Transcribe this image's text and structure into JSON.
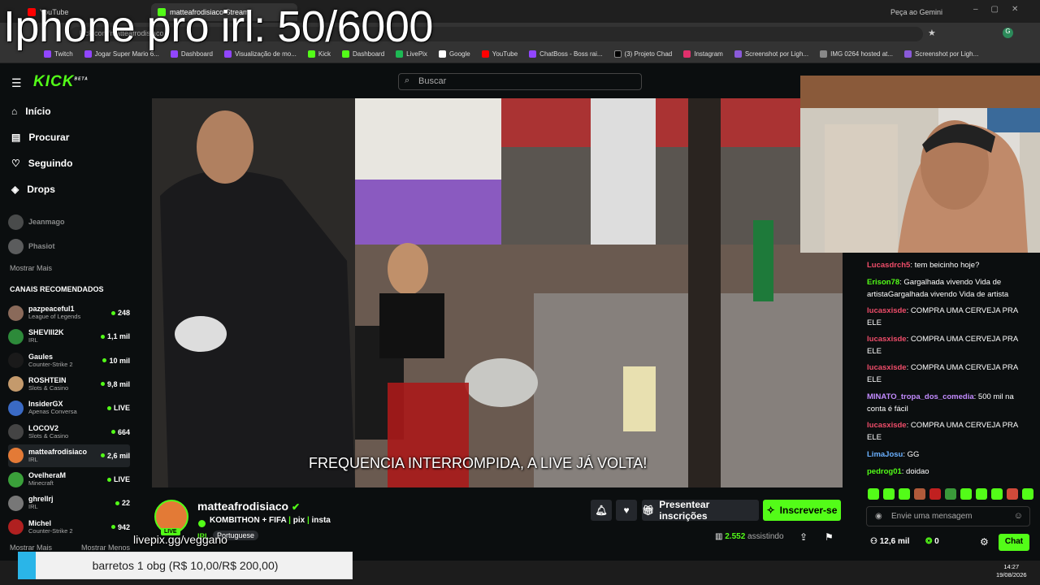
{
  "overlay": {
    "title": "Iphone pro irl: 50/6000"
  },
  "browser": {
    "tabs": [
      "YouTube",
      "matteafrodisiaco Stream",
      "Peça ao Gemini"
    ],
    "url": "kick.com/matteafrodisiaco",
    "bookmarks": [
      "Twitch",
      "Jogar Super Mario 6...",
      "Dashboard",
      "Visualização de mo...",
      "Kick",
      "Dashboard",
      "LivePix",
      "Google",
      "YouTube",
      "ChatBoss - Boss rai...",
      "(3) Projeto Chad",
      "Instagram",
      "Screenshot por Ligh...",
      "IMG 0264 hosted at...",
      "Screenshot por Ligh..."
    ]
  },
  "header": {
    "logo": "KICK",
    "logo_badge": "BETA",
    "search_placeholder": "Buscar"
  },
  "sidebar": {
    "nav": [
      {
        "label": "Início",
        "icon": "home-icon"
      },
      {
        "label": "Procurar",
        "icon": "browse-icon"
      },
      {
        "label": "Seguindo",
        "icon": "heart-icon"
      },
      {
        "label": "Drops",
        "icon": "drops-icon"
      }
    ],
    "following": [
      {
        "name": "Jeanmago"
      },
      {
        "name": "Phasiot"
      }
    ],
    "show_more": "Mostrar Mais",
    "recommended_title": "CANAIS RECOMENDADOS",
    "recommended": [
      {
        "name": "pazpeaceful1",
        "category": "League of Legends",
        "viewers": "248",
        "color": "#8a6a5a"
      },
      {
        "name": "SHEVIII2K",
        "category": "IRL",
        "viewers": "1,1 mil",
        "color": "#2d8a3a"
      },
      {
        "name": "Gaules",
        "category": "Counter-Strike 2",
        "viewers": "10 mil",
        "color": "#1a1a1a"
      },
      {
        "name": "ROSHTEIN",
        "category": "Slots & Casino",
        "viewers": "9,8 mil",
        "color": "#c49a6c"
      },
      {
        "name": "InsiderGX",
        "category": "Apenas Conversa",
        "viewers": "LIVE",
        "color": "#3a6ac4"
      },
      {
        "name": "LOCOV2",
        "category": "Slots & Casino",
        "viewers": "664",
        "color": "#444"
      },
      {
        "name": "matteafrodisiaco",
        "category": "IRL",
        "viewers": "2,6 mil",
        "color": "#e37a36"
      },
      {
        "name": "OvelheraM",
        "category": "Minecraft",
        "viewers": "LIVE",
        "color": "#3aa03a"
      },
      {
        "name": "ghrellrj",
        "category": "IRL",
        "viewers": "22",
        "color": "#777"
      },
      {
        "name": "Michel",
        "category": "Counter-Strike 2",
        "viewers": "942",
        "color": "#b02020"
      }
    ],
    "show_more2": "Mostrar Mais",
    "show_less": "Mostrar Menos"
  },
  "video": {
    "subtitle": "FREQUENCIA INTERROMPIDA, A LIVE JÁ VOLTA!"
  },
  "stream": {
    "streamer": "matteafrodisiaco",
    "title": "KOMBITHON + FIFA",
    "links": [
      "pix",
      "insta"
    ],
    "category": "IRL",
    "language": "Portuguese",
    "live_badge": "LIVE",
    "viewers": "2.552",
    "viewers_label": "assistindo",
    "gift_label": "Presentear inscrições",
    "subscribe_label": "Inscrever-se"
  },
  "chat": {
    "messages": [
      {
        "user": "Lucasdrch5",
        "color": "#f04d6a",
        "text": "tem beicinho hoje?"
      },
      {
        "user": "Erison78",
        "color": "#53fc18",
        "text": "Gargalhada vivendo Vida de artistaGargalhada vivendo Vida de artista"
      },
      {
        "user": "lucasxisde",
        "color": "#f04d6a",
        "text": "COMPRA UMA CERVEJA PRA ELE"
      },
      {
        "user": "lucasxisde",
        "color": "#f04d6a",
        "text": "COMPRA UMA CERVEJA PRA ELE"
      },
      {
        "user": "lucasxisde",
        "color": "#f04d6a",
        "text": "COMPRA UMA CERVEJA PRA ELE"
      },
      {
        "user": "MINATO_tropa_dos_comedia",
        "color": "#c38bff",
        "text": "500 mil na conta é fácil"
      },
      {
        "user": "lucasxisde",
        "color": "#f04d6a",
        "text": "COMPRA UMA CERVEJA PRA ELE"
      },
      {
        "user": "LimaJosu",
        "color": "#6ab0ff",
        "text": "GG"
      },
      {
        "user": "pedrog01",
        "color": "#53fc18",
        "text": "doidao"
      }
    ],
    "input_placeholder": "Envie uma mensagem",
    "followers": "12,6 mil",
    "points": "0",
    "chat_button": "Chat"
  },
  "donation": {
    "text": "barretos 1 obg (R$ 10,00/R$ 200,00)",
    "progress": 0.05
  },
  "livepix_text": "livepix.gg/veggano",
  "taskbar": {
    "time": "14:27",
    "date": "19/08/2026"
  }
}
